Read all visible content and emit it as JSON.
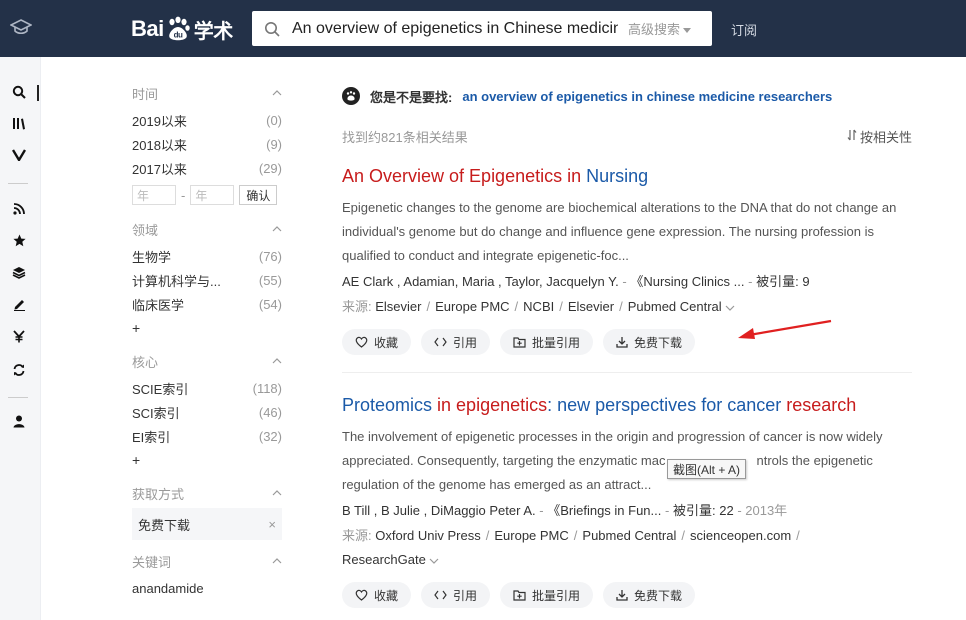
{
  "header": {
    "logo_left": "Bai",
    "logo_paw": "du",
    "logo_right": "学术",
    "search_value": "An overview of epigenetics in Chinese medicine re",
    "advanced_label": "高级搜索",
    "subscribe_label": "订阅"
  },
  "rail": {
    "icons": [
      "graduation-cap-icon",
      "search-icon",
      "library-icon",
      "v-icon",
      "rss-icon",
      "star-icon",
      "layers-icon",
      "edit-icon",
      "yen-icon",
      "refresh-icon",
      "user-icon"
    ]
  },
  "filters": {
    "time": {
      "title": "时间",
      "items": [
        {
          "label": "2019以来",
          "count": "(0)"
        },
        {
          "label": "2018以来",
          "count": "(9)"
        },
        {
          "label": "2017以来",
          "count": "(29)"
        }
      ],
      "year_from": "年",
      "year_sep": "-",
      "year_to": "年",
      "confirm": "确认"
    },
    "field": {
      "title": "领域",
      "items": [
        {
          "label": "生物学",
          "count": "(76)"
        },
        {
          "label": "计算机科学与...",
          "count": "(55)"
        },
        {
          "label": "临床医学",
          "count": "(54)"
        }
      ],
      "more": "+"
    },
    "core": {
      "title": "核心",
      "items": [
        {
          "label": "SCIE索引",
          "count": "(118)"
        },
        {
          "label": "SCI索引",
          "count": "(46)"
        },
        {
          "label": "EI索引",
          "count": "(32)"
        }
      ],
      "more": "+"
    },
    "access": {
      "title": "获取方式",
      "chip": "免费下载",
      "chip_close": "×"
    },
    "keywords": {
      "title": "关键词",
      "items": [
        "anandamide"
      ]
    }
  },
  "main": {
    "dym_label": "您是不是要找:",
    "dym_link": "an overview of epigenetics in chinese medicine researchers",
    "result_count": "找到约821条相关结果",
    "sort_label": "按相关性",
    "results": [
      {
        "title": {
          "t1": "An Overview of Epigenetics in ",
          "t2": "Nursing"
        },
        "abstract": "Epigenetic changes to the genome are biochemical alterations to the DNA that do not change an individual's genome but do change and influence gene expression. The nursing profession is qualified to conduct and integrate epigenetic-foc...",
        "authors": "AE Clark ,   Adamian, Maria ,   Taylor, Jacquelyn Y.",
        "journal": "《Nursing Clinics ...",
        "cited_label": "被引量:",
        "cited": "9",
        "year": "",
        "source_label": "来源:",
        "sources": [
          "Elsevier",
          "Europe PMC",
          "NCBI",
          "Elsevier",
          "Pubmed Central"
        ],
        "buttons": [
          "收藏",
          "引用",
          "批量引用",
          "免费下载"
        ]
      },
      {
        "title": {
          "t1": "Proteomics ",
          "t2": "in epigenetics",
          ":": ": ",
          "t3": "new perspectives for cancer ",
          "t4": "research"
        },
        "abstract": "The involvement of epigenetic processes in the origin and progression of cancer is now widely appreciated. Consequently, targeting the enzymatic machinery that controls the epigenetic regulation of the genome has emerged as an attract...",
        "abstract_visible_1": "The involvement of epigenetic processes in the origin and progression of cancer is now widely",
        "abstract_visible_2": "appreciated. Consequently, targeting the enzymatic mac",
        "abstract_visible_2b": "ntrols the epigenetic",
        "abstract_visible_3": "regulation of the genome has emerged as an attract...",
        "authors": "B Till ,   B Julie ,   DiMaggio Peter A.",
        "journal": "《Briefings in Fun...",
        "cited_label": "被引量:",
        "cited": "22",
        "year": "2013年",
        "source_label": "来源:",
        "sources": [
          "Oxford Univ Press",
          "Europe PMC",
          "Pubmed Central",
          "scienceopen.com",
          "ResearchGate"
        ],
        "buttons": [
          "收藏",
          "引用",
          "批量引用",
          "免费下载"
        ]
      }
    ]
  },
  "tooltip": "截图(Alt + A)",
  "colors": {
    "header_bg": "#233148",
    "title_red": "#c71c1c",
    "link_blue": "#1b5aa8",
    "arrow_red": "#e02020"
  }
}
